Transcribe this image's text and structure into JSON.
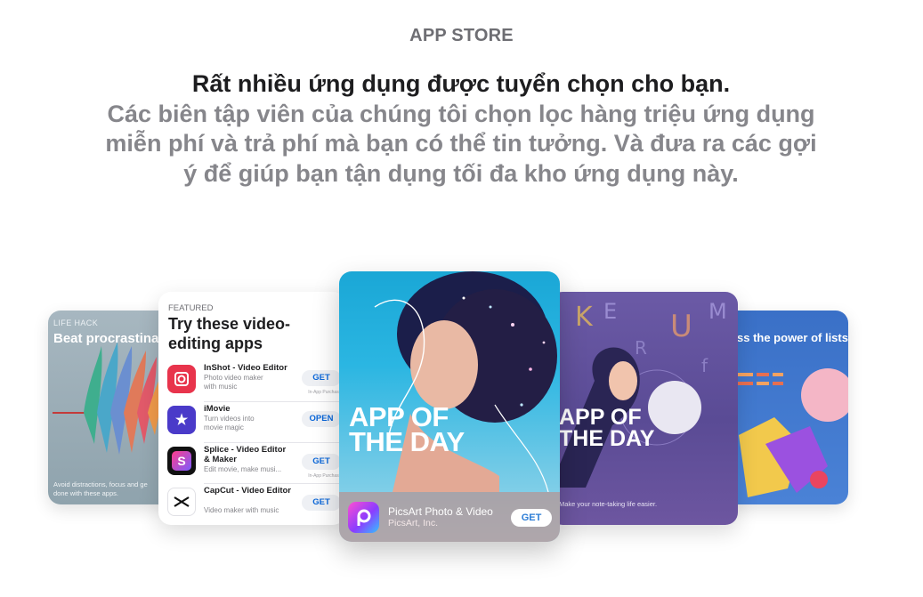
{
  "header": {
    "eyebrow": "APP STORE",
    "headline": "Rất nhiều ứng dụng được tuyển chọn cho bạn.",
    "body": "Các biên tập viên của chúng tôi chọn lọc hàng triệu ứng dụng miễn phí và trả phí mà bạn có thể tin tưởng. Và đưa ra các gợi ý để giúp bạn tận dụng tối đa kho ứng dụng này."
  },
  "cards": {
    "life_hack": {
      "eyebrow": "LIFE HACK",
      "title": "Beat procrastinat",
      "footer": "Avoid distractions, focus and ge done with these apps."
    },
    "featured": {
      "label": "FEATURED",
      "title": "Try these video-editing apps",
      "apps": [
        {
          "name": "InShot - Video Editor",
          "subtitle1": "Photo video maker",
          "subtitle2": "with music",
          "button": "GET",
          "note": "In-App Purchases",
          "color": "#e8344c"
        },
        {
          "name": "iMovie",
          "subtitle1": "Turn videos into",
          "subtitle2": "movie magic",
          "button": "OPEN",
          "note": "",
          "color": "#4a3ac9"
        },
        {
          "name": "Splice - Video Editor & Maker",
          "subtitle1": "Edit movie, make musi...",
          "subtitle2": "",
          "button": "GET",
          "note": "In-App Purchases",
          "color": "#111111"
        },
        {
          "name": "CapCut - Video Editor",
          "subtitle1": "Video maker with music",
          "subtitle2": "",
          "button": "GET",
          "note": "",
          "color": "#ffffff"
        }
      ]
    },
    "app_of_the_day": {
      "title": "APP OF THE DAY",
      "app_name": "PicsArt Photo & Video",
      "developer": "PicsArt, Inc.",
      "button": "GET"
    },
    "note_app": {
      "title": "APP OF THE DAY",
      "footer": "Make your note-taking life easier."
    },
    "power": {
      "title": "ss the power of lists"
    }
  }
}
